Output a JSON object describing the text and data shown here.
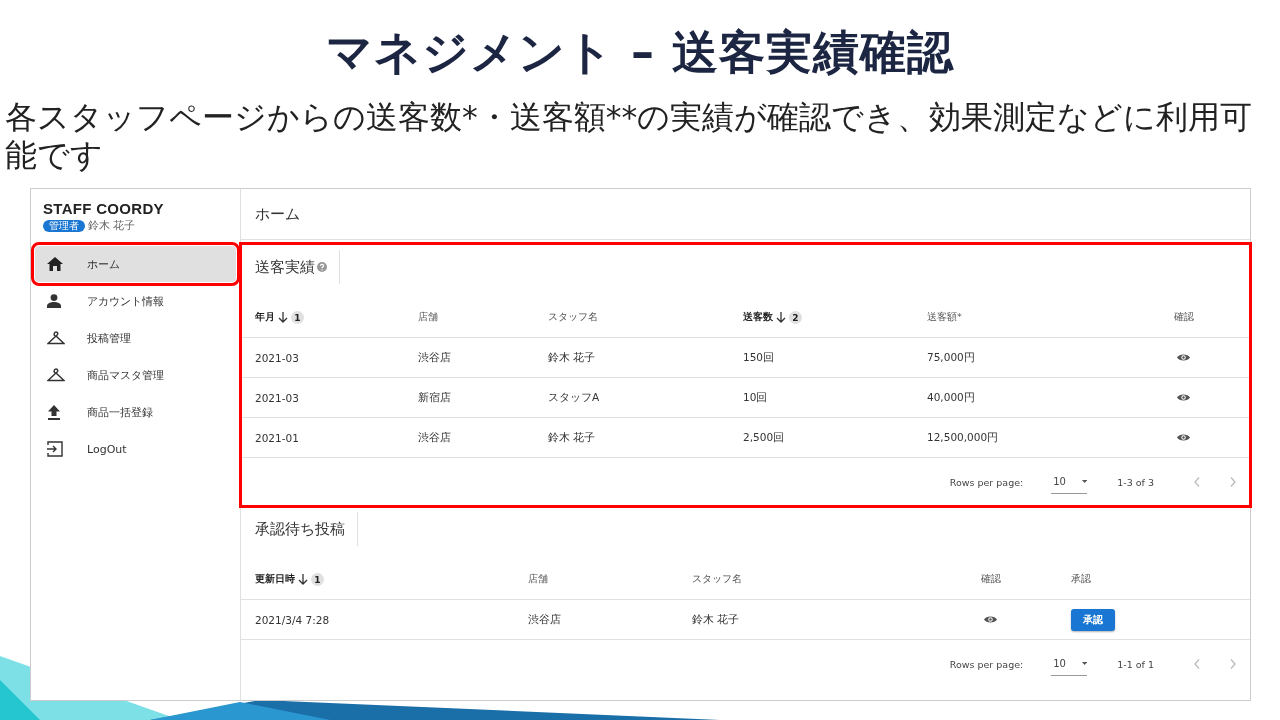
{
  "slide": {
    "title": "マネジメント – 送客実績確認",
    "description": "各スタッフページからの送客数*・送客額**の実績が確認でき、効果測定などに利用可能です"
  },
  "app": {
    "brand": "STAFF COORDY",
    "role_badge": "管理者",
    "user_name": "鈴木 花子",
    "page_title": "ホーム",
    "nav": [
      {
        "label": "ホーム",
        "kind": "home",
        "selected": true,
        "highlighted": true
      },
      {
        "label": "アカウント情報",
        "kind": "person",
        "selected": false,
        "highlighted": false
      },
      {
        "label": "投稿管理",
        "kind": "hanger",
        "selected": false,
        "highlighted": false
      },
      {
        "label": "商品マスタ管理",
        "kind": "hanger",
        "selected": false,
        "highlighted": false
      },
      {
        "label": "商品一括登録",
        "kind": "upload",
        "selected": false,
        "highlighted": false
      },
      {
        "label": "LogOut",
        "kind": "logout",
        "selected": false,
        "highlighted": false
      }
    ]
  },
  "tables": [
    {
      "title": "送客実績",
      "help_icon": true,
      "highlighted": true,
      "columns": [
        {
          "label": "年月",
          "sort_rank": "1"
        },
        {
          "label": "店舗"
        },
        {
          "label": "スタッフ名"
        },
        {
          "label": "送客数",
          "sort_rank": "2"
        },
        {
          "label": "送客額*"
        },
        {
          "label": "確認"
        }
      ],
      "rows": [
        {
          "cells": [
            {
              "kind": "text",
              "text": "2021-03"
            },
            {
              "kind": "text",
              "text": "渋谷店"
            },
            {
              "kind": "text",
              "text": "鈴木 花子"
            },
            {
              "kind": "text",
              "text": "150回"
            },
            {
              "kind": "text",
              "text": "75,000円"
            },
            {
              "kind": "view"
            }
          ]
        },
        {
          "cells": [
            {
              "kind": "text",
              "text": "2021-03"
            },
            {
              "kind": "text",
              "text": "新宿店"
            },
            {
              "kind": "text",
              "text": "スタッフA"
            },
            {
              "kind": "text",
              "text": "10回"
            },
            {
              "kind": "text",
              "text": "40,000円"
            },
            {
              "kind": "view"
            }
          ]
        },
        {
          "cells": [
            {
              "kind": "text",
              "text": "2021-01"
            },
            {
              "kind": "text",
              "text": "渋谷店"
            },
            {
              "kind": "text",
              "text": "鈴木 花子"
            },
            {
              "kind": "text",
              "text": "2,500回"
            },
            {
              "kind": "text",
              "text": "12,500,000円"
            },
            {
              "kind": "view"
            }
          ]
        }
      ],
      "footer": {
        "rows_per_page_label": "Rows per page:",
        "rows_per_page": "10",
        "range": "1-3 of 3"
      }
    },
    {
      "title": "承認待ち投稿",
      "help_icon": false,
      "highlighted": false,
      "columns": [
        {
          "label": "更新日時",
          "sort_rank": "1"
        },
        {
          "label": "店舗"
        },
        {
          "label": "スタッフ名"
        },
        {
          "label": "確認"
        },
        {
          "label": "承認"
        }
      ],
      "rows": [
        {
          "cells": [
            {
              "kind": "text",
              "text": "2021/3/4 7:28"
            },
            {
              "kind": "text",
              "text": "渋谷店"
            },
            {
              "kind": "text",
              "text": "鈴木 花子"
            },
            {
              "kind": "view"
            },
            {
              "kind": "button",
              "label": "承認"
            }
          ]
        }
      ],
      "footer": {
        "rows_per_page_label": "Rows per page:",
        "rows_per_page": "10",
        "range": "1-1 of 1"
      }
    }
  ]
}
